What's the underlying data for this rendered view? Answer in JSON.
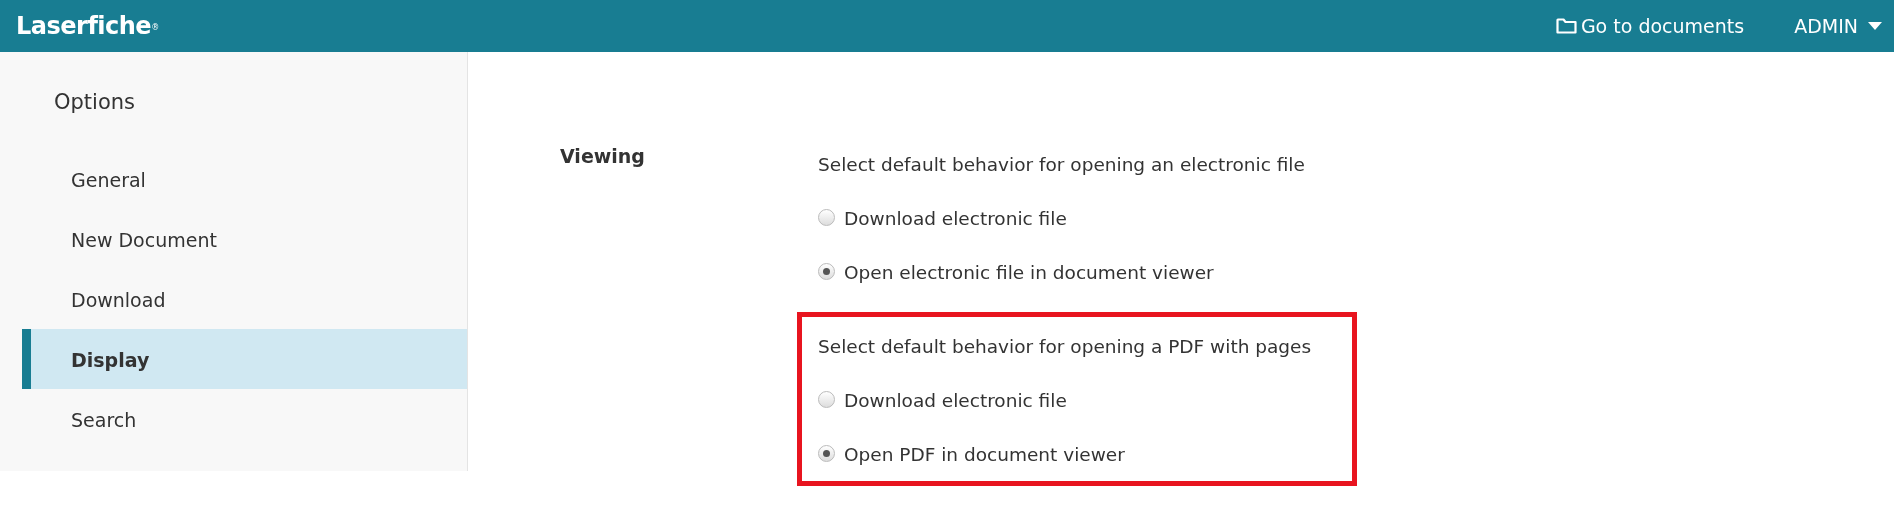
{
  "header": {
    "logo": "Laserfiche",
    "logo_mark": "®",
    "links": [
      {
        "label": "Go to documents",
        "kind": "folder"
      },
      {
        "label": "ADMIN",
        "kind": "dropdown"
      }
    ]
  },
  "sidebar": {
    "title": "Options",
    "items": [
      {
        "label": "General",
        "selected": false
      },
      {
        "label": "New Document",
        "selected": false
      },
      {
        "label": "Download",
        "selected": false
      },
      {
        "label": "Display",
        "selected": true
      },
      {
        "label": "Search",
        "selected": false
      }
    ]
  },
  "section": {
    "label": "Viewing",
    "groups": [
      {
        "prompt": "Select default behavior for opening an electronic file",
        "highlighted": false,
        "options": [
          {
            "label": "Download electronic file",
            "selected": false
          },
          {
            "label": "Open electronic file in document viewer",
            "selected": true
          }
        ]
      },
      {
        "prompt": "Select default behavior for opening a PDF with pages",
        "highlighted": true,
        "options": [
          {
            "label": "Download electronic file",
            "selected": false
          },
          {
            "label": "Open PDF in document viewer",
            "selected": true
          }
        ]
      }
    ]
  }
}
